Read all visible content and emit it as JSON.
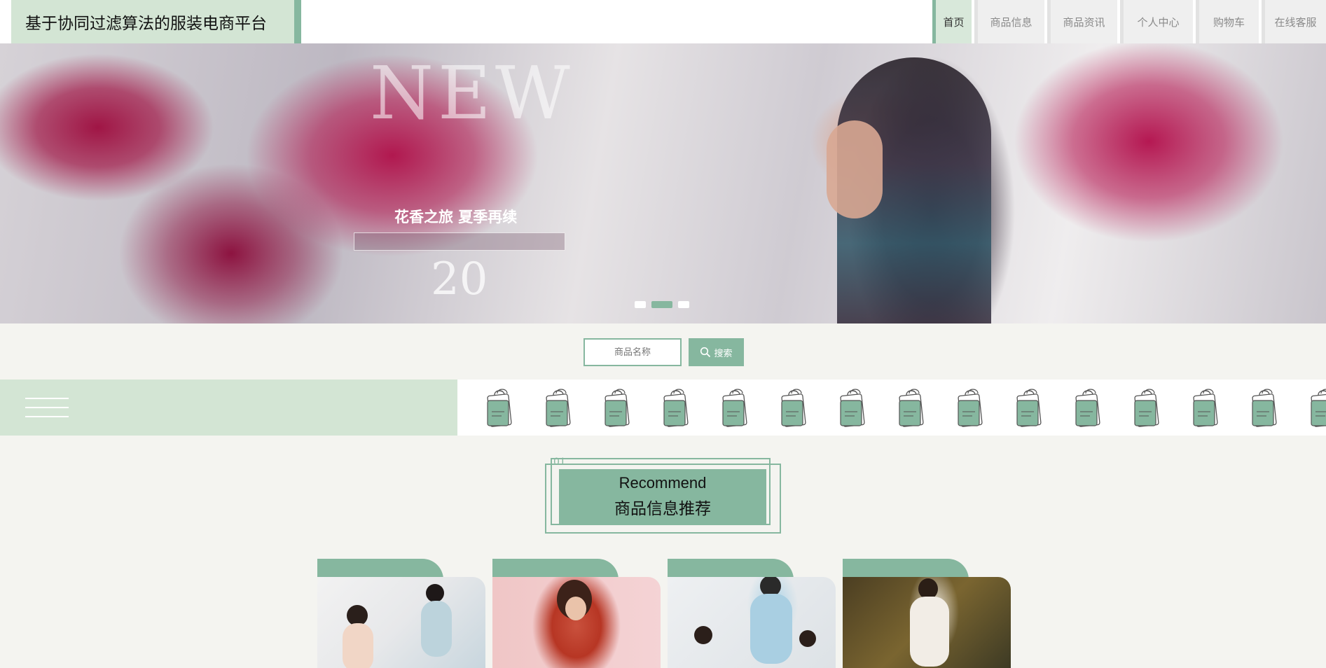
{
  "header": {
    "site_title": "基于协同过滤算法的服装电商平台",
    "nav": [
      {
        "label": "首页",
        "active": true
      },
      {
        "label": "商品信息",
        "active": false
      },
      {
        "label": "商品资讯",
        "active": false
      },
      {
        "label": "个人中心",
        "active": false
      },
      {
        "label": "购物车",
        "active": false
      },
      {
        "label": "在线客服",
        "active": false
      }
    ]
  },
  "banner": {
    "headline": "NEW",
    "caption": "花香之旅 夏季再续",
    "number": "20",
    "slide_count": 3,
    "active_slide": 2
  },
  "search": {
    "placeholder": "商品名称",
    "button_label": "搜索"
  },
  "section": {
    "number": "01",
    "title_en": "Recommend",
    "title_cn": "商品信息推荐"
  },
  "colors": {
    "accent": "#86b79f",
    "accent_light": "#d3e5d4",
    "page_bg": "#f4f4f0"
  }
}
